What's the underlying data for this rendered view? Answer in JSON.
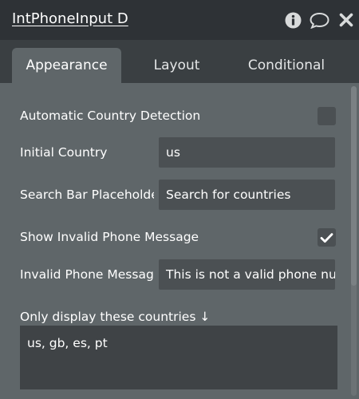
{
  "header": {
    "title": "IntPhoneInput D",
    "icons": [
      "info-icon",
      "comment-icon",
      "close-icon"
    ]
  },
  "tabs": [
    {
      "label": "Appearance",
      "active": true
    },
    {
      "label": "Layout",
      "active": false
    },
    {
      "label": "Conditional",
      "active": false
    }
  ],
  "fields": {
    "auto_country": {
      "label": "Automatic Country Detection",
      "checked": false
    },
    "initial_country": {
      "label": "Initial Country",
      "value": "us"
    },
    "search_placeholder": {
      "label": "Search Bar Placeholde",
      "value": "Search for countries"
    },
    "show_invalid": {
      "label": "Show Invalid Phone Message",
      "checked": true
    },
    "invalid_message": {
      "label": "Invalid Phone Messag",
      "value": "This is not a valid phone num"
    },
    "only_countries": {
      "label": "Only display these countries ↓",
      "value": "us, gb, es, pt"
    }
  },
  "colors": {
    "header_bg": "#2e3236",
    "panel_bg": "#5f6669",
    "input_bg": "#4b5053",
    "textarea_bg": "#3f4346"
  }
}
